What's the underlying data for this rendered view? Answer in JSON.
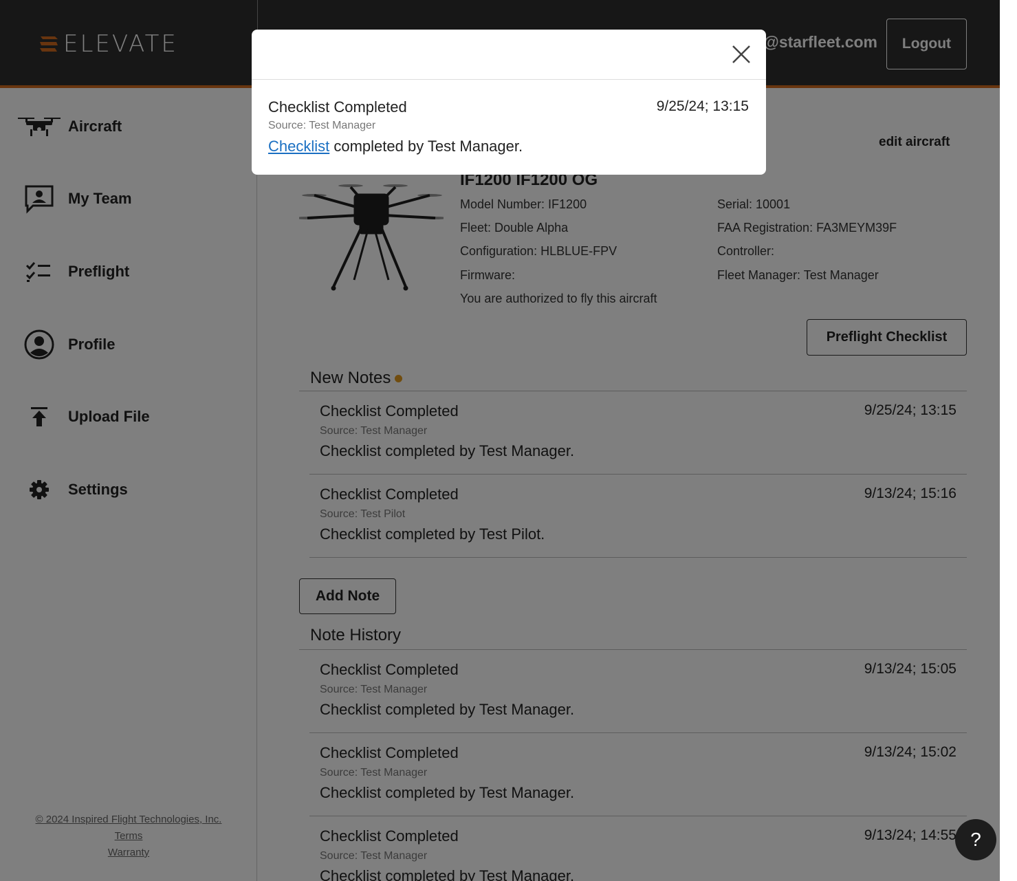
{
  "header": {
    "logo_text": "ELEVATE",
    "user_email": "@starfleet.com",
    "logout_label": "Logout"
  },
  "sidebar": {
    "items": [
      {
        "label": "Aircraft",
        "icon": "drone-icon"
      },
      {
        "label": "My Team",
        "icon": "team-icon"
      },
      {
        "label": "Preflight",
        "icon": "checklist-icon"
      },
      {
        "label": "Profile",
        "icon": "profile-icon"
      },
      {
        "label": "Upload File",
        "icon": "upload-icon"
      },
      {
        "label": "Settings",
        "icon": "gear-icon"
      }
    ],
    "footer": {
      "copyright": "© 2024 Inspired Flight Technologies, Inc.",
      "terms": "Terms",
      "warranty": "Warranty"
    }
  },
  "aircraft": {
    "edit_label": "edit aircraft",
    "title": "IF1200 IF1200 OG",
    "model_number": "Model Number: IF1200",
    "fleet": "Fleet: Double Alpha",
    "configuration": "Configuration: HLBLUE-FPV",
    "firmware": "Firmware:",
    "authorization": "You are authorized to fly this aircraft",
    "serial": "Serial: 10001",
    "faa_registration": "FAA Registration: FA3MEYM39F",
    "controller": "Controller:",
    "fleet_manager": "Fleet Manager: Test Manager",
    "preflight_label": "Preflight Checklist"
  },
  "new_notes": {
    "title": "New Notes",
    "items": [
      {
        "title": "Checklist Completed",
        "date": "9/25/24; 13:15",
        "source": "Source: Test Manager",
        "body": "Checklist completed by Test Manager."
      },
      {
        "title": "Checklist Completed",
        "date": "9/13/24; 15:16",
        "source": "Source: Test Pilot",
        "body": "Checklist completed by Test Pilot."
      }
    ]
  },
  "add_note_label": "Add Note",
  "note_history": {
    "title": "Note History",
    "items": [
      {
        "title": "Checklist Completed",
        "date": "9/13/24; 15:05",
        "source": "Source: Test Manager",
        "body": "Checklist completed by Test Manager."
      },
      {
        "title": "Checklist Completed",
        "date": "9/13/24; 15:02",
        "source": "Source: Test Manager",
        "body": "Checklist completed by Test Manager."
      },
      {
        "title": "Checklist Completed",
        "date": "9/13/24; 14:55",
        "source": "Source: Test Manager",
        "body": "Checklist completed by Test Manager."
      }
    ]
  },
  "modal": {
    "title": "Checklist Completed",
    "date": "9/25/24; 13:15",
    "source": "Source: Test Manager",
    "link_text": "Checklist",
    "body_rest": " completed by Test Manager."
  },
  "help_label": "?",
  "colors": {
    "accent": "#d06a1e",
    "header_bg": "#2f2f2f",
    "link": "#1a6fc2",
    "new_dot": "#e29a1e"
  }
}
